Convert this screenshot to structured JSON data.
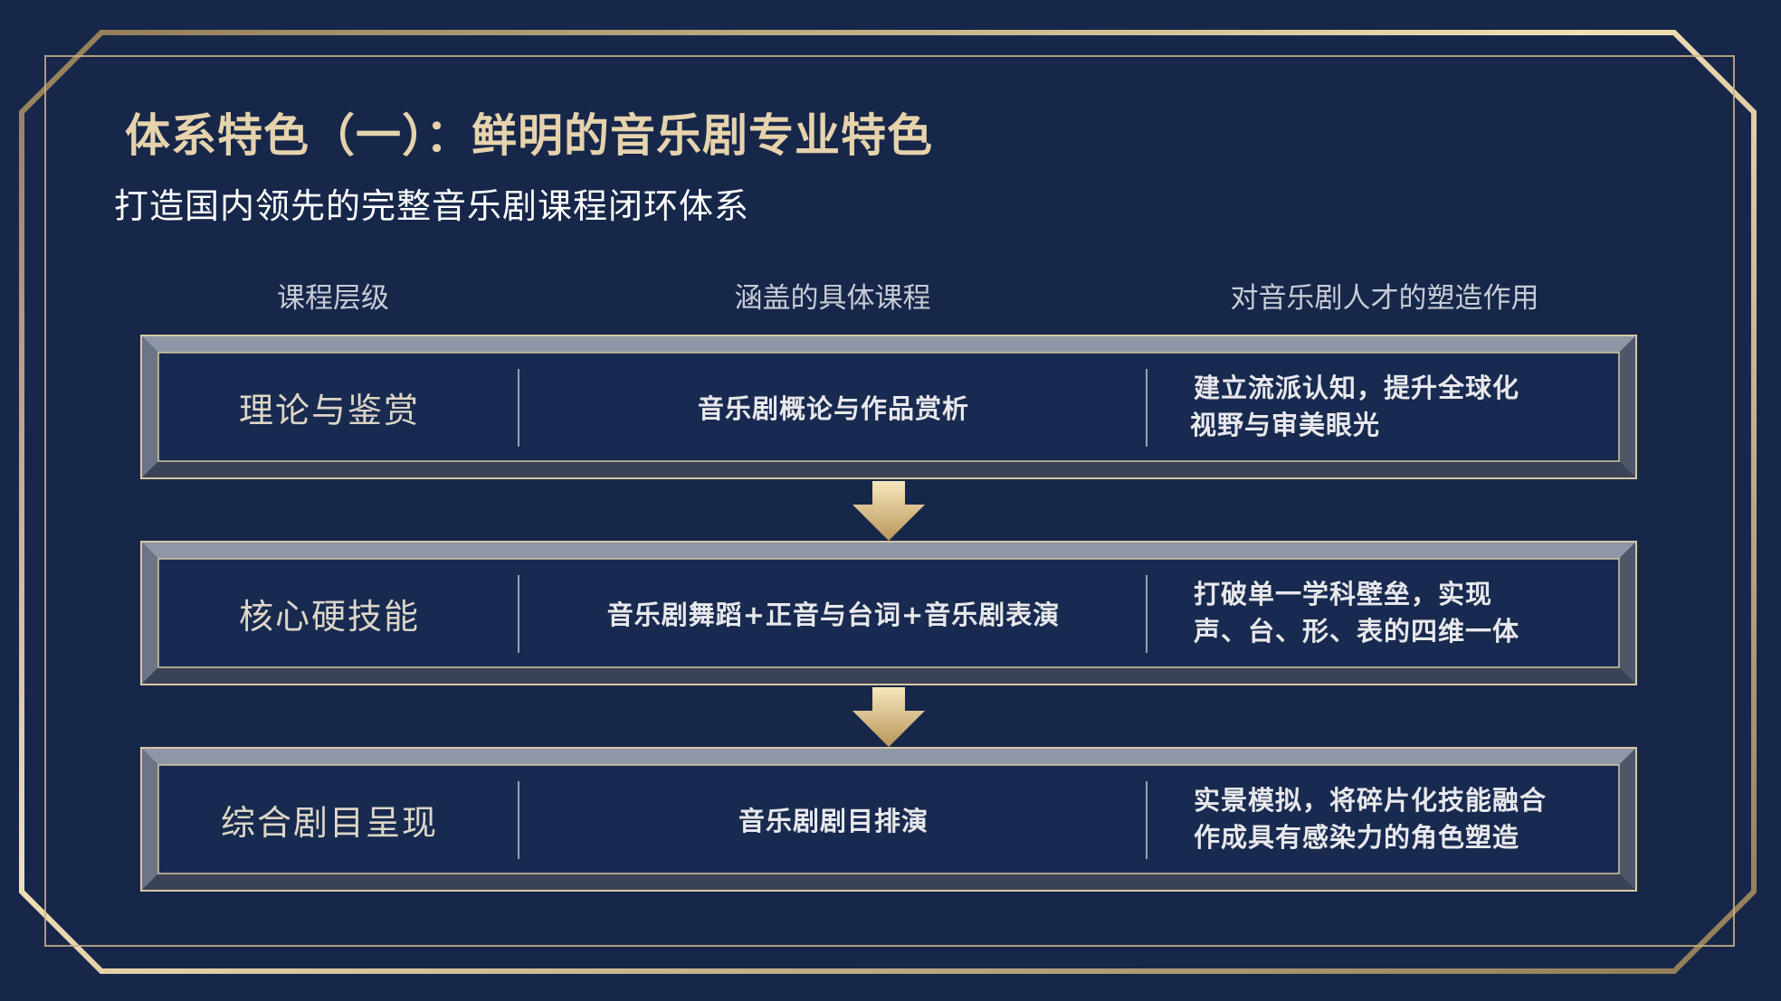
{
  "header": {
    "title": "体系特色（一）：鲜明的音乐剧专业特色",
    "subtitle": "打造国内领先的完整音乐剧课程闭环体系"
  },
  "table": {
    "columns": [
      "课程层级",
      "涵盖的具体课程",
      "对音乐剧人才的塑造作用"
    ],
    "rows": [
      {
        "level": "理论与鉴赏",
        "course": "音乐剧概论与作品赏析",
        "effect": [
          "建立流派认知，提升全球化",
          "视野与审美眼光"
        ]
      },
      {
        "level": "核心硬技能",
        "course": "音乐剧舞蹈+正音与台词+音乐剧表演",
        "effect": [
          "打破单一学科壁垒，实现",
          "声、台、形、表的四维一体"
        ]
      },
      {
        "level": "综合剧目呈现",
        "course": "音乐剧剧目排演",
        "effect": [
          "实景模拟，将碎片化技能融合",
          "作成具有感染力的角色塑造"
        ]
      }
    ]
  },
  "colors": {
    "background": "#17274a",
    "gold": "#d9c08c",
    "title": "#e6d3ac",
    "text": "#e8e8ec"
  }
}
